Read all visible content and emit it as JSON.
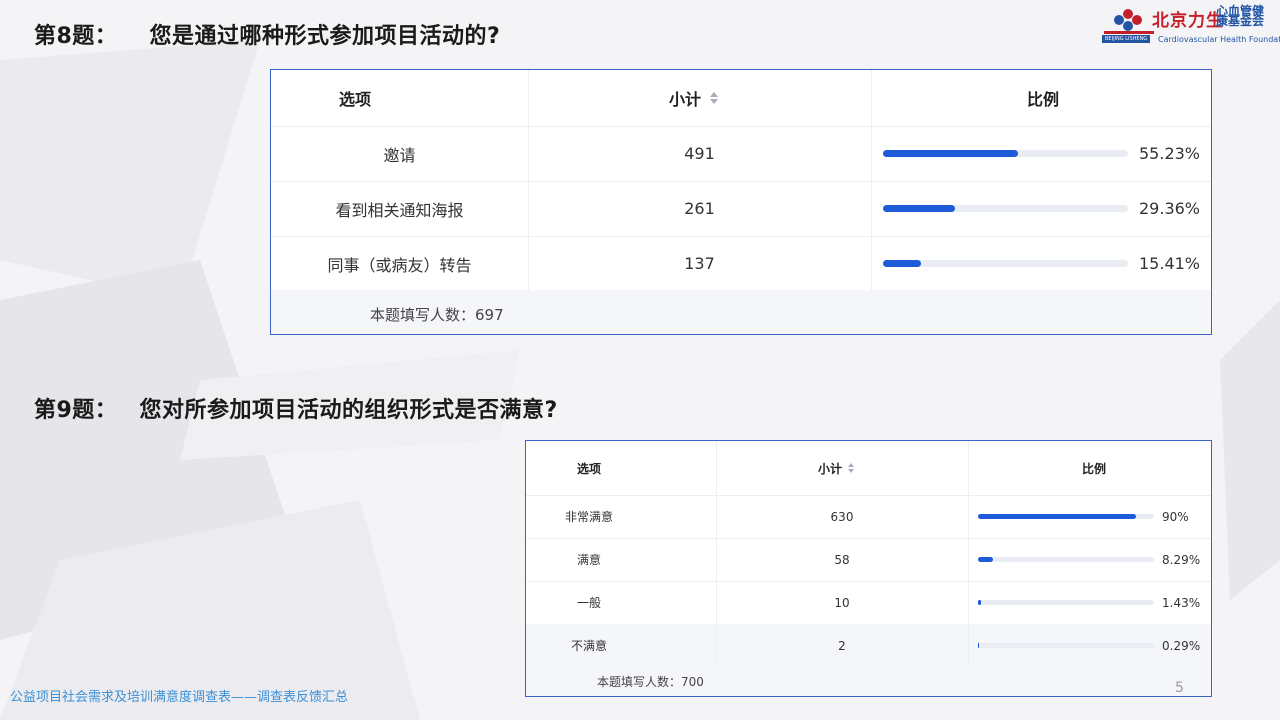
{
  "header": {
    "logo_cn": "北京力生",
    "logo_cn2": "心血管健康基金会",
    "logo_en": "Cardiovascular Health Foundation",
    "logo_tag": "BEIJING LISHENG"
  },
  "q8": {
    "number": "第8题：",
    "question": "您是通过哪种形式参加项目活动的?",
    "col_option": "选项",
    "col_count": "小计",
    "col_ratio": "比例",
    "rows": [
      {
        "option": "邀请",
        "count": "491",
        "ratio": "55.23%",
        "fraction": 0.5523
      },
      {
        "option": "看到相关通知海报",
        "count": "261",
        "ratio": "29.36%",
        "fraction": 0.2936
      },
      {
        "option": "同事（或病友）转告",
        "count": "137",
        "ratio": "15.41%",
        "fraction": 0.1541
      }
    ],
    "total": "本题填写人数：697"
  },
  "q9": {
    "number": "第9题：",
    "question": "您对所参加项目活动的组织形式是否满意?",
    "col_option": "选项",
    "col_count": "小计",
    "col_ratio": "比例",
    "rows": [
      {
        "option": "非常满意",
        "count": "630",
        "ratio": "90%",
        "fraction": 0.9
      },
      {
        "option": "满意",
        "count": "58",
        "ratio": "8.29%",
        "fraction": 0.0829
      },
      {
        "option": "一般",
        "count": "10",
        "ratio": "1.43%",
        "fraction": 0.0143
      },
      {
        "option": "不满意",
        "count": "2",
        "ratio": "0.29%",
        "fraction": 0.0029
      }
    ],
    "total": "本题填写人数：700"
  },
  "footer": {
    "text": "公益项目社会需求及培训满意度调查表——调查表反馈汇总",
    "page": "5"
  },
  "colors": {
    "bar": "#1d5bd8",
    "track": "#e9ecf3",
    "border": "#3d63c8",
    "footer_text": "#3a8fd6"
  }
}
